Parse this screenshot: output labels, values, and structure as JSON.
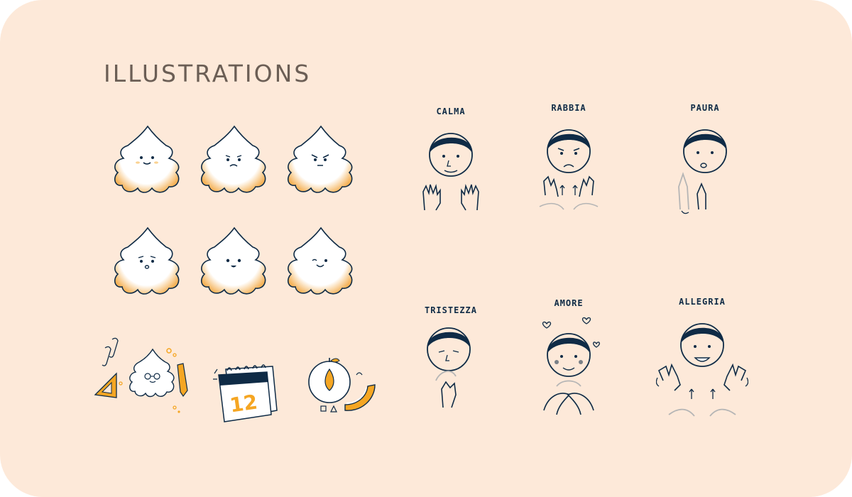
{
  "page": {
    "section_title": "ILLUSTRATIONS"
  },
  "creatures": [
    {
      "expression": "smiling",
      "icon": "smiling-creature-icon"
    },
    {
      "expression": "sad",
      "icon": "sad-creature-icon"
    },
    {
      "expression": "angry",
      "icon": "angry-creature-icon"
    },
    {
      "expression": "worried",
      "icon": "worried-creature-icon"
    },
    {
      "expression": "surprised",
      "icon": "surprised-creature-icon"
    },
    {
      "expression": "playful",
      "icon": "playful-creature-icon"
    }
  ],
  "stickers": [
    {
      "icon": "school-supplies-creature-icon"
    },
    {
      "icon": "calendar-icon",
      "calendar_number": "12"
    },
    {
      "icon": "apple-slice-icon"
    }
  ],
  "emotions": [
    {
      "label": "CALMA",
      "icon": "calm-gesture-icon"
    },
    {
      "label": "RABBIA",
      "icon": "anger-gesture-icon"
    },
    {
      "label": "PAURA",
      "icon": "fear-gesture-icon"
    },
    {
      "label": "TRISTEZZA",
      "icon": "sadness-gesture-icon"
    },
    {
      "label": "AMORE",
      "icon": "love-gesture-icon"
    },
    {
      "label": "ALLEGRIA",
      "icon": "joy-gesture-icon"
    }
  ],
  "colors": {
    "background": "#fde9d9",
    "title": "#6b5e55",
    "ink": "#0f2b46",
    "accent_orange": "#f5a623",
    "creature_fill": "#ffffff",
    "hand_ghost": "#b5b5b5"
  }
}
